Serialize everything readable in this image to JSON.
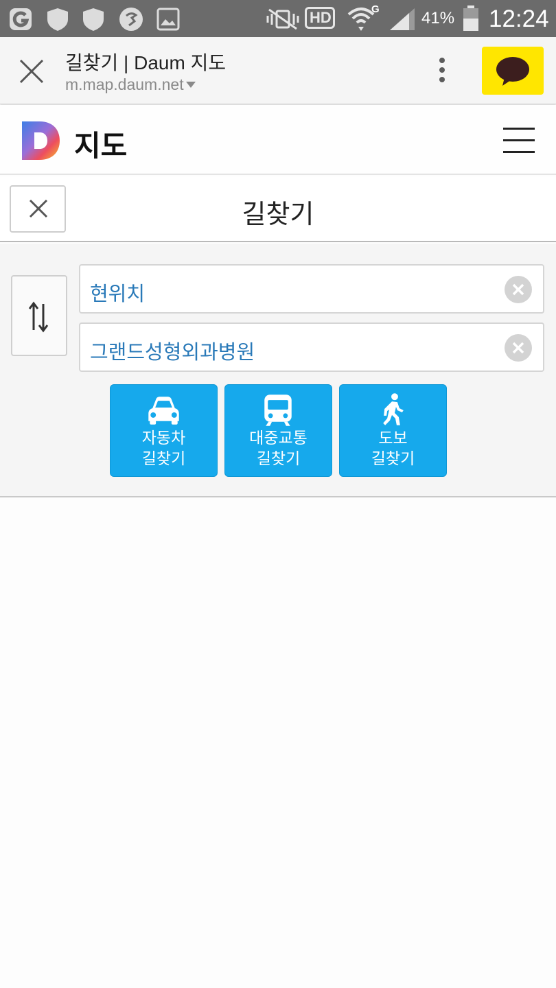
{
  "status_bar": {
    "battery": "41%",
    "time": "12:24",
    "network_badge": "G",
    "hd_badge": "HD"
  },
  "browser": {
    "tab_title": "길찾기 | Daum 지도",
    "url": "m.map.daum.net"
  },
  "header": {
    "brand": "지도",
    "accent_colors": [
      "#3d7fe6",
      "#f5c02a",
      "#ee4d5e"
    ]
  },
  "page": {
    "title": "길찾기"
  },
  "search": {
    "origin": "현위치",
    "destination": "그랜드성형외과병원"
  },
  "route_buttons": [
    {
      "line1": "자동차",
      "line2": "길찾기",
      "icon": "car-icon"
    },
    {
      "line1": "대중교통",
      "line2": "길찾기",
      "icon": "train-icon"
    },
    {
      "line1": "도보",
      "line2": "길찾기",
      "icon": "walk-icon"
    }
  ],
  "colors": {
    "route_button": "#16a9ec",
    "field_text": "#2979b8",
    "kakao_yellow": "#ffe600"
  }
}
